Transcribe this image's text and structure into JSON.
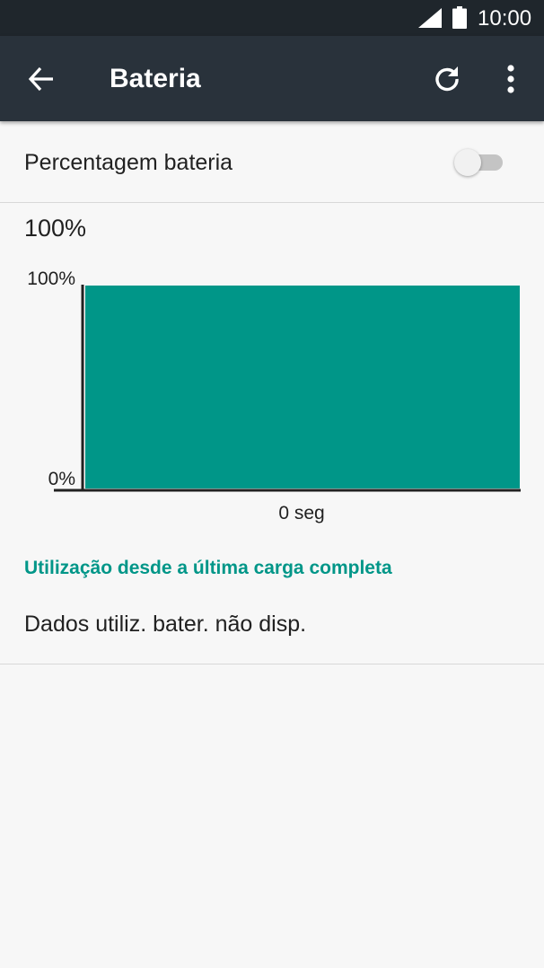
{
  "status_bar": {
    "time": "10:00",
    "icons": [
      "cellular-signal-icon",
      "battery-full-icon"
    ]
  },
  "app_bar": {
    "title": "Bateria",
    "icons": [
      "back-arrow-icon",
      "refresh-icon",
      "more-vert-icon"
    ]
  },
  "battery_percentage_pref": {
    "label": "Percentagem bateria",
    "enabled": false
  },
  "battery_level": "100%",
  "chart_data": {
    "type": "area",
    "x": [
      0,
      1
    ],
    "values": [
      100,
      100
    ],
    "ylim": [
      0,
      100
    ],
    "yticks": [
      "100%",
      "0%"
    ],
    "xlabel": "0 seg",
    "color": "#009688"
  },
  "usage": {
    "header": "Utilização desde a última carga completa",
    "text": "Dados utiliz. bater. não disp."
  },
  "colors": {
    "status_bar": "#1f262c",
    "app_bar": "#29323b",
    "accent": "#009688",
    "background": "#f7f7f7"
  }
}
